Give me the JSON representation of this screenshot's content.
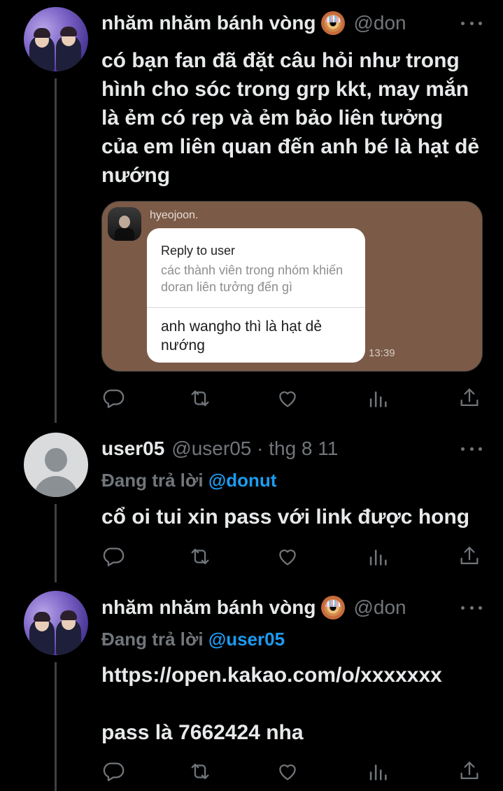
{
  "tweets": [
    {
      "name": "nhăm nhăm bánh vòng",
      "handle": "@don",
      "text": "có bạn fan đã đặt câu hỏi như trong hình cho sóc trong grp kkt, may mắn là ẻm có rep và ẻm bảo liên tưởng của em liên quan đến anh bé là hạt dẻ nướng",
      "media": {
        "chat_name": "hyeojoon.",
        "reply_title": "Reply to user",
        "quoted_question": "các thành viên trong nhóm khiến doran liên tưởng đến gì",
        "answer": "anh wangho thì là hạt dẻ nướng",
        "time": "13:39"
      }
    },
    {
      "name": "user05",
      "handle": "@user05 · thg 8 11",
      "replying_prefix": "Đang trả lời ",
      "replying_to": "@donut",
      "text": "cổ oi tui xin pass với link được hong"
    },
    {
      "name": "nhăm nhăm bánh vòng",
      "handle": "@don",
      "replying_prefix": "Đang trả lời ",
      "replying_to": "@user05",
      "text": "https://open.kakao.com/o/xxxxxxx\n\npass là 7662424 nha"
    }
  ],
  "icons": {
    "reply": "speech-bubble",
    "retweet": "retweet-arrows",
    "like": "heart",
    "views": "bar-chart",
    "share": "share-arrow",
    "more": "three-dots"
  },
  "colors": {
    "background": "#000000",
    "text": "#e7e9ea",
    "muted": "#71767b",
    "mention": "#1d9bf0",
    "chat_background": "#7b5a47"
  }
}
